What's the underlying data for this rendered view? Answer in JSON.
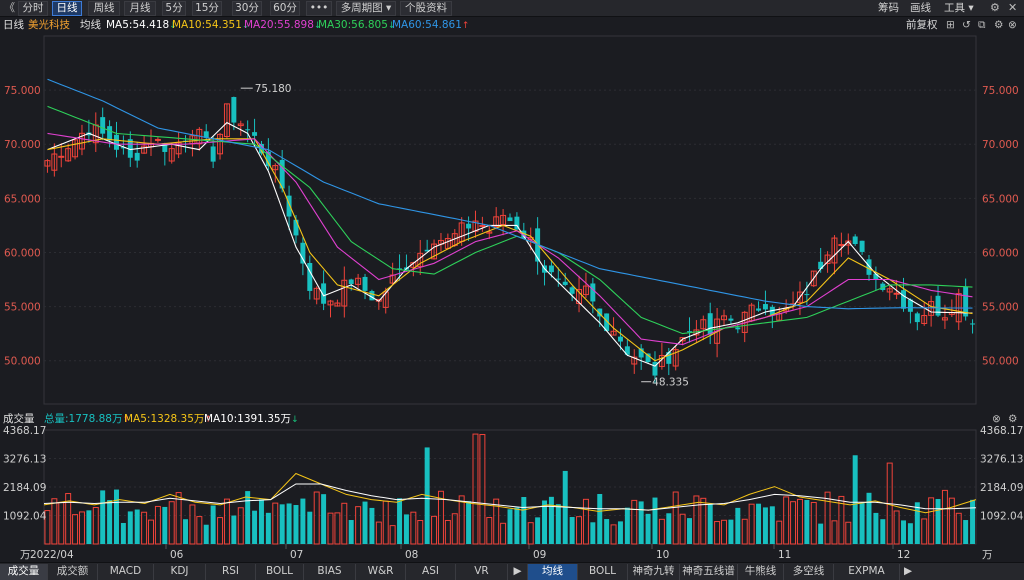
{
  "toolbar": {
    "collapse_glyph": "《",
    "tabs": [
      "分时",
      "日线",
      "周线",
      "月线",
      "5分",
      "15分",
      "30分",
      "60分",
      "•••",
      "多周期图 ▾",
      "个股资料"
    ],
    "active_tab": "日线",
    "right": [
      "筹码",
      "画线",
      "工具 ▾"
    ],
    "icons": [
      "settings-gear-icon",
      "close-icon"
    ]
  },
  "legend": {
    "period": "日线",
    "stock": "美光科技",
    "ma_label": "均线",
    "ma": [
      {
        "name": "MA5",
        "text": "MA5:54.418",
        "dir": "down",
        "color": "#ffffff"
      },
      {
        "name": "MA10",
        "text": "MA10:54.351",
        "dir": "down",
        "color": "#f5c518"
      },
      {
        "name": "MA20",
        "text": "MA20:55.898",
        "dir": "down",
        "color": "#e040d0"
      },
      {
        "name": "MA30",
        "text": "MA30:56.805",
        "dir": "down",
        "color": "#2ed15a"
      },
      {
        "name": "MA60",
        "text": "MA60:54.861",
        "dir": "up",
        "color": "#2f95e6"
      }
    ],
    "adjust": "前复权",
    "arrow_up": "↑",
    "arrow_down": "↓"
  },
  "volume_legend": {
    "label": "成交量",
    "total": "总量:1778.88万",
    "ma5": "MA5:1328.35万",
    "ma10": "MA10:1391.35万",
    "total_dir": "up",
    "ma5_dir": "up",
    "ma10_dir": "down",
    "unit": "万"
  },
  "colors": {
    "up": "#f0433a",
    "down": "#18c0c0",
    "background": "#1b1c21"
  },
  "chart_data": {
    "type": "candlestick",
    "price_axis": {
      "labels": [
        "75.000",
        "70.000",
        "65.000",
        "60.000",
        "55.000",
        "50.000"
      ],
      "ylim": [
        46,
        80
      ]
    },
    "volume_axis": {
      "labels": [
        "4368.17",
        "3276.13",
        "2184.09",
        "1092.04"
      ],
      "unit": "万",
      "ylim": [
        0,
        4368.17
      ]
    },
    "x_labels": [
      "2022/04",
      "06",
      "07",
      "08",
      "09",
      "10",
      "11",
      "12"
    ],
    "annotations": {
      "high": "75.180",
      "low": "48.335"
    },
    "close_path": [
      [
        0,
        68.5
      ],
      [
        3,
        70
      ],
      [
        6,
        71.5
      ],
      [
        9,
        70.5
      ],
      [
        12,
        68.5
      ],
      [
        15,
        70.5
      ],
      [
        18,
        69.5
      ],
      [
        21,
        71.5
      ],
      [
        24,
        69
      ],
      [
        26,
        73
      ],
      [
        28,
        72
      ],
      [
        30,
        70.5
      ],
      [
        32,
        68.5
      ],
      [
        34,
        66
      ],
      [
        36,
        61.5
      ],
      [
        38,
        57
      ],
      [
        40,
        55.5
      ],
      [
        42,
        56
      ],
      [
        44,
        57.5
      ],
      [
        46,
        56.5
      ],
      [
        48,
        55.5
      ],
      [
        50,
        57.5
      ],
      [
        52,
        59
      ],
      [
        54,
        60
      ],
      [
        56,
        61.5
      ],
      [
        58,
        61
      ],
      [
        60,
        62
      ],
      [
        62,
        63
      ],
      [
        64,
        62
      ],
      [
        66,
        63.5
      ],
      [
        68,
        62.5
      ],
      [
        70,
        61
      ],
      [
        72,
        58.5
      ],
      [
        74,
        57
      ],
      [
        76,
        55.5
      ],
      [
        78,
        56.5
      ],
      [
        80,
        54
      ],
      [
        82,
        53
      ],
      [
        84,
        51
      ],
      [
        86,
        50
      ],
      [
        88,
        49
      ],
      [
        90,
        50.5
      ],
      [
        92,
        52
      ],
      [
        94,
        53.5
      ],
      [
        96,
        52.5
      ],
      [
        98,
        54
      ],
      [
        100,
        53.5
      ],
      [
        102,
        54.5
      ],
      [
        104,
        55.5
      ],
      [
        106,
        54
      ],
      [
        108,
        55
      ],
      [
        110,
        56.5
      ],
      [
        112,
        59
      ],
      [
        114,
        62
      ],
      [
        116,
        61
      ],
      [
        118,
        59.5
      ],
      [
        120,
        57.5
      ],
      [
        122,
        57
      ],
      [
        124,
        55.5
      ],
      [
        126,
        54
      ],
      [
        128,
        55
      ],
      [
        130,
        54.5
      ],
      [
        132,
        56
      ],
      [
        134,
        53.5
      ]
    ],
    "ma_paths": {
      "MA5": [
        [
          0,
          69.5
        ],
        [
          6,
          71
        ],
        [
          12,
          69.5
        ],
        [
          18,
          70
        ],
        [
          22,
          69.5
        ],
        [
          26,
          72
        ],
        [
          29,
          71
        ],
        [
          32,
          67.5
        ],
        [
          36,
          60.5
        ],
        [
          40,
          56
        ],
        [
          44,
          57
        ],
        [
          48,
          55.5
        ],
        [
          52,
          58.5
        ],
        [
          56,
          60.5
        ],
        [
          60,
          61.5
        ],
        [
          64,
          62.5
        ],
        [
          68,
          62.5
        ],
        [
          72,
          58.5
        ],
        [
          76,
          56
        ],
        [
          80,
          53.5
        ],
        [
          84,
          50.5
        ],
        [
          88,
          49.5
        ],
        [
          92,
          52
        ],
        [
          96,
          53
        ],
        [
          100,
          53.5
        ],
        [
          104,
          54.5
        ],
        [
          108,
          55
        ],
        [
          112,
          58.5
        ],
        [
          116,
          61
        ],
        [
          120,
          58
        ],
        [
          124,
          56
        ],
        [
          128,
          54.5
        ],
        [
          134,
          54.4
        ]
      ],
      "MA10": [
        [
          0,
          69.5
        ],
        [
          8,
          70.5
        ],
        [
          16,
          70
        ],
        [
          24,
          70.5
        ],
        [
          30,
          70.5
        ],
        [
          34,
          66
        ],
        [
          38,
          60
        ],
        [
          42,
          57
        ],
        [
          48,
          56
        ],
        [
          54,
          59
        ],
        [
          60,
          61
        ],
        [
          66,
          62.5
        ],
        [
          70,
          61.5
        ],
        [
          76,
          57
        ],
        [
          82,
          53
        ],
        [
          88,
          50
        ],
        [
          92,
          51
        ],
        [
          98,
          53
        ],
        [
          104,
          54
        ],
        [
          110,
          55.5
        ],
        [
          116,
          59.5
        ],
        [
          122,
          57.5
        ],
        [
          128,
          55
        ],
        [
          134,
          54.35
        ]
      ],
      "MA20": [
        [
          0,
          71
        ],
        [
          10,
          70
        ],
        [
          20,
          70
        ],
        [
          30,
          70.5
        ],
        [
          36,
          66.5
        ],
        [
          42,
          60.5
        ],
        [
          48,
          57.5
        ],
        [
          56,
          59
        ],
        [
          62,
          61
        ],
        [
          68,
          62
        ],
        [
          74,
          59.5
        ],
        [
          80,
          56
        ],
        [
          86,
          52
        ],
        [
          92,
          51.5
        ],
        [
          98,
          53
        ],
        [
          104,
          54
        ],
        [
          110,
          55
        ],
        [
          116,
          57.5
        ],
        [
          122,
          57.5
        ],
        [
          128,
          56.5
        ],
        [
          134,
          55.9
        ]
      ],
      "MA30": [
        [
          0,
          73.5
        ],
        [
          10,
          71
        ],
        [
          20,
          70.5
        ],
        [
          30,
          70
        ],
        [
          38,
          66
        ],
        [
          44,
          61
        ],
        [
          50,
          58.5
        ],
        [
          56,
          58
        ],
        [
          62,
          60
        ],
        [
          68,
          61.5
        ],
        [
          74,
          60
        ],
        [
          80,
          57.5
        ],
        [
          86,
          54
        ],
        [
          92,
          52.5
        ],
        [
          98,
          53
        ],
        [
          104,
          53.5
        ],
        [
          110,
          54
        ],
        [
          116,
          55.5
        ],
        [
          122,
          57
        ],
        [
          128,
          57
        ],
        [
          134,
          56.8
        ]
      ],
      "MA60": [
        [
          0,
          76
        ],
        [
          8,
          74
        ],
        [
          16,
          71.5
        ],
        [
          24,
          70.5
        ],
        [
          32,
          69.5
        ],
        [
          40,
          66.5
        ],
        [
          48,
          64.5
        ],
        [
          56,
          63.5
        ],
        [
          64,
          62.5
        ],
        [
          72,
          60.5
        ],
        [
          80,
          58.5
        ],
        [
          88,
          57.5
        ],
        [
          96,
          56.5
        ],
        [
          104,
          55.5
        ],
        [
          110,
          55
        ],
        [
          116,
          54.8
        ],
        [
          124,
          54.9
        ],
        [
          134,
          54.86
        ]
      ]
    },
    "volume_ma5": [
      1500,
      1650,
      1500,
      1700,
      1550,
      1900,
      1600,
      1500,
      1800,
      1700,
      2700,
      2300,
      1900,
      1700,
      1600,
      1900,
      1700,
      1550,
      1450,
      1300,
      1500,
      1400,
      1250,
      1350,
      1300,
      1450,
      1600,
      1500,
      1900,
      2200,
      1800,
      1650,
      1500,
      1650,
      1400,
      1200,
      1400,
      1700
    ],
    "volume_ma10": [
      1550,
      1600,
      1550,
      1600,
      1600,
      1750,
      1650,
      1550,
      1650,
      1700,
      2300,
      2300,
      2050,
      1850,
      1700,
      1750,
      1700,
      1600,
      1500,
      1400,
      1450,
      1400,
      1350,
      1350,
      1300,
      1400,
      1500,
      1550,
      1700,
      1900,
      1850,
      1750,
      1600,
      1600,
      1500,
      1350,
      1350,
      1390
    ]
  },
  "bottom_tabs": [
    "成交量",
    "成交额",
    "MACD",
    "KDJ",
    "RSI",
    "BOLL",
    "BIAS",
    "W&R",
    "ASI",
    "VR",
    "▶",
    "均线",
    "BOLL",
    "神奇九转",
    "神奇五线谱",
    "牛熊线",
    "多空线",
    "EXPMA",
    "▶"
  ]
}
